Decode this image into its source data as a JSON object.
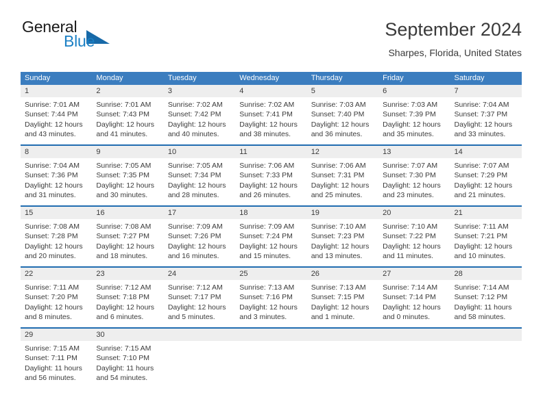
{
  "brand": {
    "name_part1": "General",
    "name_part2": "Blue",
    "accent_color": "#1a7fc4",
    "triangle_color": "#1769a8"
  },
  "header": {
    "title": "September 2024",
    "subtitle": "Sharpes, Florida, United States"
  },
  "calendar": {
    "header_bg": "#3b7dbf",
    "row_border_color": "#1f6cb0",
    "day_band_bg": "#eeeeee",
    "day_names": [
      "Sunday",
      "Monday",
      "Tuesday",
      "Wednesday",
      "Thursday",
      "Friday",
      "Saturday"
    ],
    "weeks": [
      [
        {
          "day": "1",
          "sunrise": "Sunrise: 7:01 AM",
          "sunset": "Sunset: 7:44 PM",
          "daylight1": "Daylight: 12 hours",
          "daylight2": "and 43 minutes."
        },
        {
          "day": "2",
          "sunrise": "Sunrise: 7:01 AM",
          "sunset": "Sunset: 7:43 PM",
          "daylight1": "Daylight: 12 hours",
          "daylight2": "and 41 minutes."
        },
        {
          "day": "3",
          "sunrise": "Sunrise: 7:02 AM",
          "sunset": "Sunset: 7:42 PM",
          "daylight1": "Daylight: 12 hours",
          "daylight2": "and 40 minutes."
        },
        {
          "day": "4",
          "sunrise": "Sunrise: 7:02 AM",
          "sunset": "Sunset: 7:41 PM",
          "daylight1": "Daylight: 12 hours",
          "daylight2": "and 38 minutes."
        },
        {
          "day": "5",
          "sunrise": "Sunrise: 7:03 AM",
          "sunset": "Sunset: 7:40 PM",
          "daylight1": "Daylight: 12 hours",
          "daylight2": "and 36 minutes."
        },
        {
          "day": "6",
          "sunrise": "Sunrise: 7:03 AM",
          "sunset": "Sunset: 7:39 PM",
          "daylight1": "Daylight: 12 hours",
          "daylight2": "and 35 minutes."
        },
        {
          "day": "7",
          "sunrise": "Sunrise: 7:04 AM",
          "sunset": "Sunset: 7:37 PM",
          "daylight1": "Daylight: 12 hours",
          "daylight2": "and 33 minutes."
        }
      ],
      [
        {
          "day": "8",
          "sunrise": "Sunrise: 7:04 AM",
          "sunset": "Sunset: 7:36 PM",
          "daylight1": "Daylight: 12 hours",
          "daylight2": "and 31 minutes."
        },
        {
          "day": "9",
          "sunrise": "Sunrise: 7:05 AM",
          "sunset": "Sunset: 7:35 PM",
          "daylight1": "Daylight: 12 hours",
          "daylight2": "and 30 minutes."
        },
        {
          "day": "10",
          "sunrise": "Sunrise: 7:05 AM",
          "sunset": "Sunset: 7:34 PM",
          "daylight1": "Daylight: 12 hours",
          "daylight2": "and 28 minutes."
        },
        {
          "day": "11",
          "sunrise": "Sunrise: 7:06 AM",
          "sunset": "Sunset: 7:33 PM",
          "daylight1": "Daylight: 12 hours",
          "daylight2": "and 26 minutes."
        },
        {
          "day": "12",
          "sunrise": "Sunrise: 7:06 AM",
          "sunset": "Sunset: 7:31 PM",
          "daylight1": "Daylight: 12 hours",
          "daylight2": "and 25 minutes."
        },
        {
          "day": "13",
          "sunrise": "Sunrise: 7:07 AM",
          "sunset": "Sunset: 7:30 PM",
          "daylight1": "Daylight: 12 hours",
          "daylight2": "and 23 minutes."
        },
        {
          "day": "14",
          "sunrise": "Sunrise: 7:07 AM",
          "sunset": "Sunset: 7:29 PM",
          "daylight1": "Daylight: 12 hours",
          "daylight2": "and 21 minutes."
        }
      ],
      [
        {
          "day": "15",
          "sunrise": "Sunrise: 7:08 AM",
          "sunset": "Sunset: 7:28 PM",
          "daylight1": "Daylight: 12 hours",
          "daylight2": "and 20 minutes."
        },
        {
          "day": "16",
          "sunrise": "Sunrise: 7:08 AM",
          "sunset": "Sunset: 7:27 PM",
          "daylight1": "Daylight: 12 hours",
          "daylight2": "and 18 minutes."
        },
        {
          "day": "17",
          "sunrise": "Sunrise: 7:09 AM",
          "sunset": "Sunset: 7:26 PM",
          "daylight1": "Daylight: 12 hours",
          "daylight2": "and 16 minutes."
        },
        {
          "day": "18",
          "sunrise": "Sunrise: 7:09 AM",
          "sunset": "Sunset: 7:24 PM",
          "daylight1": "Daylight: 12 hours",
          "daylight2": "and 15 minutes."
        },
        {
          "day": "19",
          "sunrise": "Sunrise: 7:10 AM",
          "sunset": "Sunset: 7:23 PM",
          "daylight1": "Daylight: 12 hours",
          "daylight2": "and 13 minutes."
        },
        {
          "day": "20",
          "sunrise": "Sunrise: 7:10 AM",
          "sunset": "Sunset: 7:22 PM",
          "daylight1": "Daylight: 12 hours",
          "daylight2": "and 11 minutes."
        },
        {
          "day": "21",
          "sunrise": "Sunrise: 7:11 AM",
          "sunset": "Sunset: 7:21 PM",
          "daylight1": "Daylight: 12 hours",
          "daylight2": "and 10 minutes."
        }
      ],
      [
        {
          "day": "22",
          "sunrise": "Sunrise: 7:11 AM",
          "sunset": "Sunset: 7:20 PM",
          "daylight1": "Daylight: 12 hours",
          "daylight2": "and 8 minutes."
        },
        {
          "day": "23",
          "sunrise": "Sunrise: 7:12 AM",
          "sunset": "Sunset: 7:18 PM",
          "daylight1": "Daylight: 12 hours",
          "daylight2": "and 6 minutes."
        },
        {
          "day": "24",
          "sunrise": "Sunrise: 7:12 AM",
          "sunset": "Sunset: 7:17 PM",
          "daylight1": "Daylight: 12 hours",
          "daylight2": "and 5 minutes."
        },
        {
          "day": "25",
          "sunrise": "Sunrise: 7:13 AM",
          "sunset": "Sunset: 7:16 PM",
          "daylight1": "Daylight: 12 hours",
          "daylight2": "and 3 minutes."
        },
        {
          "day": "26",
          "sunrise": "Sunrise: 7:13 AM",
          "sunset": "Sunset: 7:15 PM",
          "daylight1": "Daylight: 12 hours",
          "daylight2": "and 1 minute."
        },
        {
          "day": "27",
          "sunrise": "Sunrise: 7:14 AM",
          "sunset": "Sunset: 7:14 PM",
          "daylight1": "Daylight: 12 hours",
          "daylight2": "and 0 minutes."
        },
        {
          "day": "28",
          "sunrise": "Sunrise: 7:14 AM",
          "sunset": "Sunset: 7:12 PM",
          "daylight1": "Daylight: 11 hours",
          "daylight2": "and 58 minutes."
        }
      ],
      [
        {
          "day": "29",
          "sunrise": "Sunrise: 7:15 AM",
          "sunset": "Sunset: 7:11 PM",
          "daylight1": "Daylight: 11 hours",
          "daylight2": "and 56 minutes."
        },
        {
          "day": "30",
          "sunrise": "Sunrise: 7:15 AM",
          "sunset": "Sunset: 7:10 PM",
          "daylight1": "Daylight: 11 hours",
          "daylight2": "and 54 minutes."
        },
        {
          "day": "",
          "sunrise": "",
          "sunset": "",
          "daylight1": "",
          "daylight2": ""
        },
        {
          "day": "",
          "sunrise": "",
          "sunset": "",
          "daylight1": "",
          "daylight2": ""
        },
        {
          "day": "",
          "sunrise": "",
          "sunset": "",
          "daylight1": "",
          "daylight2": ""
        },
        {
          "day": "",
          "sunrise": "",
          "sunset": "",
          "daylight1": "",
          "daylight2": ""
        },
        {
          "day": "",
          "sunrise": "",
          "sunset": "",
          "daylight1": "",
          "daylight2": ""
        }
      ]
    ]
  }
}
